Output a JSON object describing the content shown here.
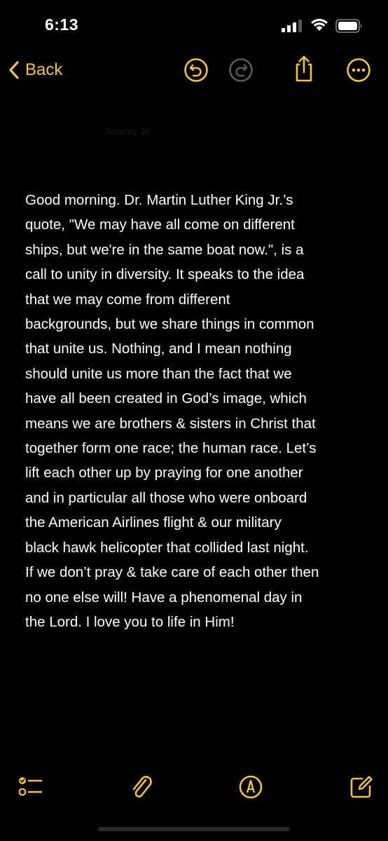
{
  "status_bar": {
    "time": "6:13"
  },
  "nav": {
    "back_label": "Back",
    "title_faint": "January 30 ...",
    "icons": [
      "undo-icon",
      "redo-icon",
      "share-icon",
      "more-icon"
    ]
  },
  "note": {
    "body": "Good morning. Dr. Martin Luther King Jr.’s\nquote, \"We may have all come on different\nships, but we're in the same boat now.\",  is a\ncall to unity in diversity. It speaks to the idea\nthat we may come from different\nbackgrounds, but we share things in common\nthat unite us. Nothing, and I mean nothing\nshould unite us more than the fact that we\nhave all been created in God’s image, which\nmeans we are brothers & sisters in Christ that\ntogether form one race; the human race. Let’s\nlift each other up by praying for one another\nand in particular all those who were onboard\nthe American Airlines flight & our military\nblack hawk helicopter that collided last night.\nIf we don’t pray & take care of each other then\nno one else will! Have a phenomenal day in\nthe Lord. I love you to life in Him!"
  },
  "toolbar": {
    "icons": [
      "checklist-icon",
      "paperclip-icon",
      "markup-icon",
      "compose-icon"
    ]
  },
  "colors": {
    "accent": "#f5c242",
    "background": "#000000",
    "text": "#ffffff"
  }
}
